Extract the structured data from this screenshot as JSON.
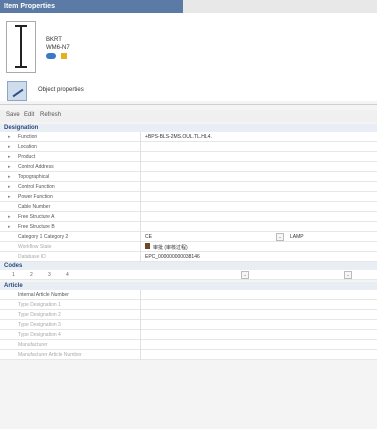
{
  "window": {
    "title": "Item Properties"
  },
  "device": {
    "name": "BKRT",
    "code": "WM6-N7"
  },
  "object_properties": {
    "label": "Object properties"
  },
  "toolbar": {
    "save": "Save",
    "edit": "Edit",
    "refresh": "Refresh"
  },
  "designation": {
    "header": "Designation",
    "rows": [
      {
        "label": "Function",
        "value": "+BPS-BLS-2MS.OUL.TL.HL4."
      },
      {
        "label": "Location",
        "value": ""
      },
      {
        "label": "Product",
        "value": ""
      },
      {
        "label": "Control Address",
        "value": ""
      },
      {
        "label": "Topographical",
        "value": ""
      },
      {
        "label": "Control Function",
        "value": ""
      },
      {
        "label": "Power Function",
        "value": ""
      },
      {
        "label": "Cable Number",
        "value": ""
      },
      {
        "label": "Free Structure A",
        "value": ""
      },
      {
        "label": "Free Structure B",
        "value": ""
      }
    ],
    "category": {
      "label": "Category 1 Category 2",
      "value": "CE",
      "right_value": "LAMP"
    },
    "workflow": {
      "label": "Workflow State",
      "value": "审批 (审核过程)"
    },
    "database": {
      "label": "Database ID",
      "value": "EPC_000000000038146"
    }
  },
  "codes": {
    "header": "Codes",
    "cells": [
      "1",
      "2",
      "3",
      "4"
    ]
  },
  "article": {
    "header": "Article",
    "rows": [
      {
        "label": "Internal Article Number"
      },
      {
        "label": "Type Designation 1"
      },
      {
        "label": "Type Designation 2"
      },
      {
        "label": "Type Designation 3"
      },
      {
        "label": "Type Designation 4"
      },
      {
        "label": "Manufacturer"
      },
      {
        "label": "Manufacturer Article Number"
      }
    ]
  },
  "colors": {
    "accent": "#5b7ba6",
    "section_bg": "#e9eef5",
    "status_blue": "#3a78c8",
    "status_yellow": "#e3b21a"
  }
}
